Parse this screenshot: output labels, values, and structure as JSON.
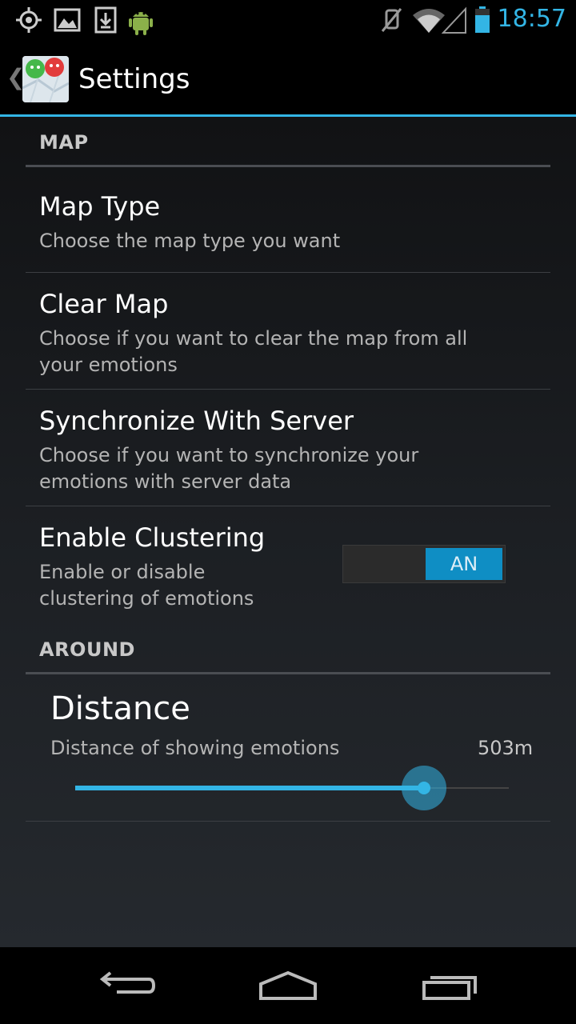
{
  "status_bar": {
    "time": "18:57",
    "left_icons": [
      "gps-icon",
      "image-icon",
      "download-icon",
      "android-icon"
    ],
    "right_icons": [
      "mute-icon",
      "wifi-icon",
      "signal-icon",
      "battery-icon"
    ]
  },
  "action_bar": {
    "title": "Settings",
    "app_icon": "app-map-icon"
  },
  "categories": {
    "map": "MAP",
    "around": "AROUND"
  },
  "preferences": {
    "map_type": {
      "title": "Map Type",
      "summary": "Choose the map type you want"
    },
    "clear_map": {
      "title": "Clear Map",
      "summary": "Choose if you want to clear the map from all your emotions"
    },
    "sync": {
      "title": "Synchronize With Server",
      "summary": "Choose if you want to synchronize your emotions with server data"
    },
    "clustering": {
      "title": "Enable Clustering",
      "summary": "Enable or disable clustering of emotions",
      "switch_label": "AN",
      "enabled": true
    },
    "distance": {
      "title": "Distance",
      "summary": "Distance of showing emotions",
      "value_label": "503m",
      "level": 0.805
    }
  },
  "colors": {
    "accent": "#33b5e5",
    "switch_on": "#0f8ec4"
  },
  "nav_bar": [
    "back-icon",
    "home-icon",
    "recent-apps-icon"
  ]
}
